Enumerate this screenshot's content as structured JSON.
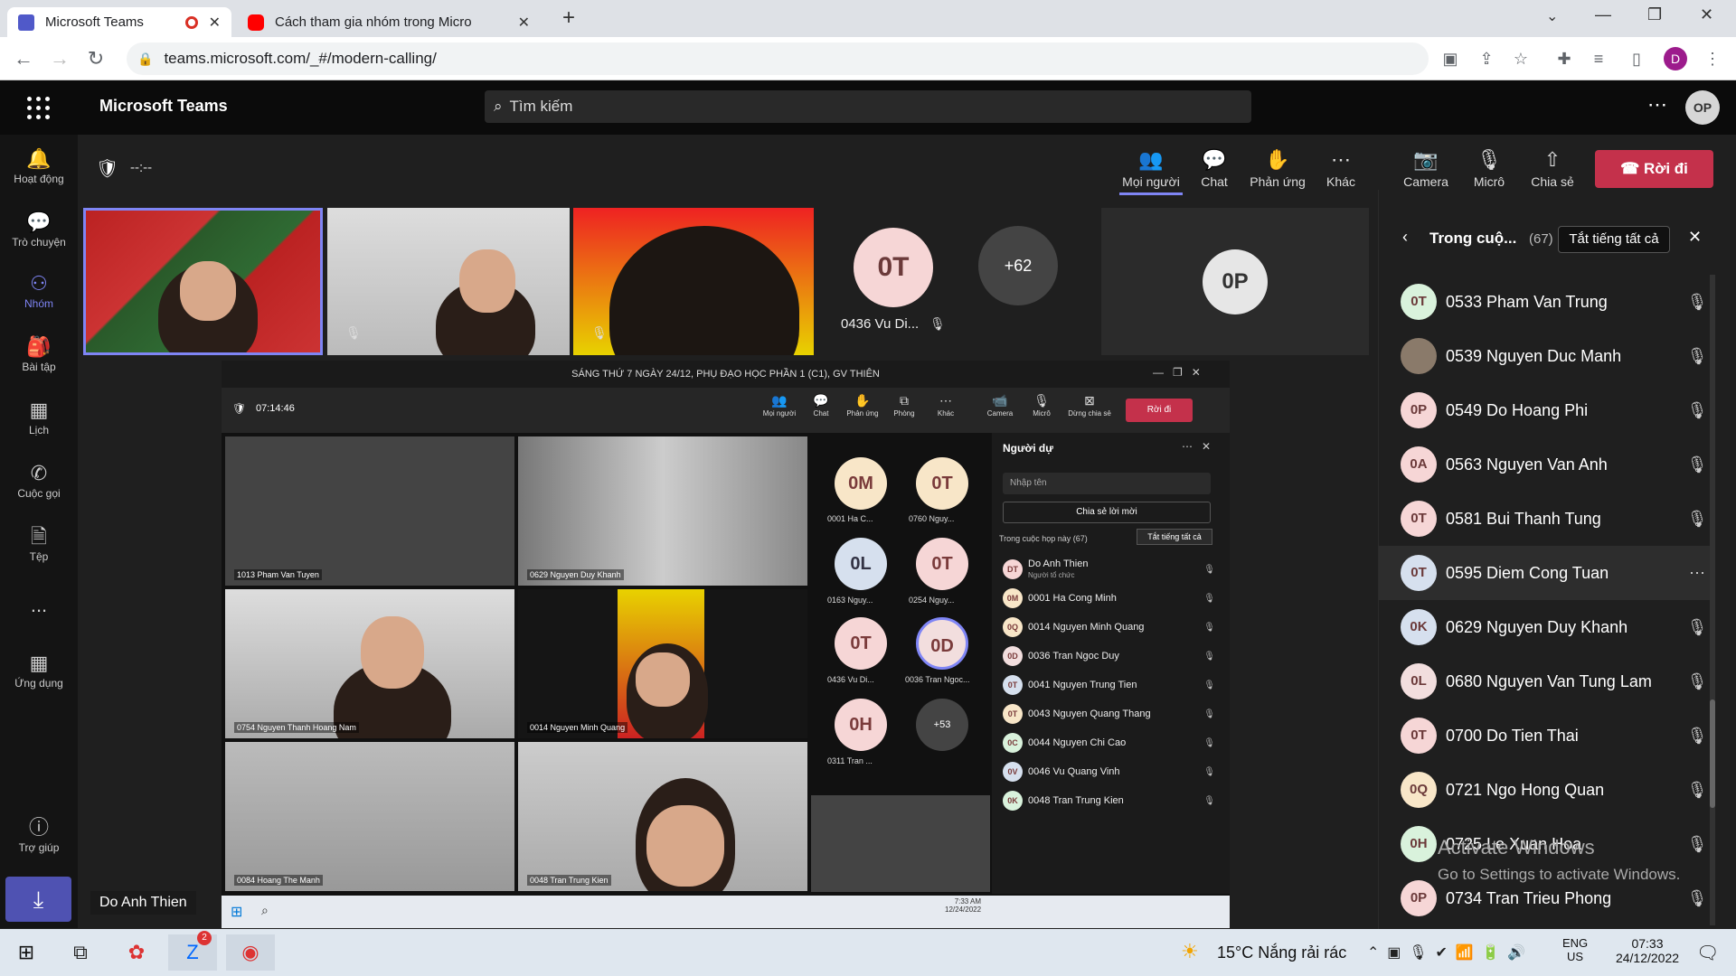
{
  "browser": {
    "tabs": [
      {
        "label": "Microsoft Teams",
        "active": true
      },
      {
        "label": "Cách tham gia nhóm trong Micro",
        "active": false
      }
    ],
    "new_tab": "+",
    "url": "teams.microsoft.com/_#/modern-calling/",
    "profile_initial": "D"
  },
  "teams": {
    "app_title": "Microsoft Teams",
    "search_placeholder": "Tìm kiếm",
    "user_initials": "OP",
    "rail": [
      {
        "label": "Hoạt động",
        "icon": "bell-icon"
      },
      {
        "label": "Trò chuyện",
        "icon": "chat-icon"
      },
      {
        "label": "Nhóm",
        "icon": "teams-icon",
        "selected": true
      },
      {
        "label": "Bài tập",
        "icon": "assignment-icon"
      },
      {
        "label": "Lịch",
        "icon": "calendar-icon"
      },
      {
        "label": "Cuộc gọi",
        "icon": "phone-icon"
      },
      {
        "label": "Tệp",
        "icon": "file-icon"
      },
      {
        "label": "...",
        "icon": "more-icon"
      },
      {
        "label": "Ứng dụng",
        "icon": "apps-icon"
      },
      {
        "label": "Trợ giúp",
        "icon": "help-icon"
      }
    ],
    "download_tooltip": "Do Anh Thien"
  },
  "meeting": {
    "timer": "--:--",
    "toolbar": [
      {
        "label": "Mọi người",
        "icon": "people-icon"
      },
      {
        "label": "Chat",
        "icon": "chat-icon"
      },
      {
        "label": "Phản ứng",
        "icon": "hand-icon"
      },
      {
        "label": "Khác",
        "icon": "more-icon"
      },
      {
        "label": "Camera",
        "icon": "camera-off-icon"
      },
      {
        "label": "Micrô",
        "icon": "mic-off-icon"
      },
      {
        "label": "Chia sẻ",
        "icon": "share-icon"
      }
    ],
    "leave_label": "Rời đi",
    "tiles": {
      "avatar_initials": "0T",
      "avatar_name": "0436 Vu Di...",
      "overflow": "+62",
      "self_initials": "0P"
    }
  },
  "shared_screen": {
    "title": "SÁNG THỨ 7 NGÀY 24/12, PHỤ ĐẠO HỌC PHẦN 1 (C1), GV THIÊN",
    "timer": "07:14:46",
    "toolbar": [
      "Mọi người",
      "Chat",
      "Phản ứng",
      "Phòng",
      "Khác",
      "Camera",
      "Micrô",
      "Dừng chia sẻ"
    ],
    "leave_label": "Rời đi",
    "video_labels": [
      "1013 Pham Van Tuyen",
      "0629 Nguyen Duy Khanh",
      "0754 Nguyen Thanh Hoang Nam",
      "0014 Nguyen Minh Quang",
      "0084 Hoang The Manh",
      "0048 Tran Trung Kien"
    ],
    "avatars": [
      {
        "i": "0M",
        "n": "0001 Ha C..."
      },
      {
        "i": "0T",
        "n": "0760 Nguy..."
      },
      {
        "i": "0L",
        "n": "0163 Nguy..."
      },
      {
        "i": "0T",
        "n": "0254 Nguy..."
      },
      {
        "i": "0T",
        "n": "0436 Vu Di..."
      },
      {
        "i": "0D",
        "n": "0036 Tran Ngoc..."
      },
      {
        "i": "0H",
        "n": "0311 Tran ..."
      }
    ],
    "overflow": "+53",
    "panel": {
      "title": "Người dự",
      "search_placeholder": "Nhập tên",
      "share_invite": "Chia sẻ lời mời",
      "section": "Trong cuộc họp này (67)",
      "mute_all": "Tắt tiếng tất cả",
      "people": [
        {
          "i": "DT",
          "n": "Do Anh Thien",
          "sub": "Người tổ chức"
        },
        {
          "i": "0M",
          "n": "0001 Ha Cong Minh"
        },
        {
          "i": "0Q",
          "n": "0014 Nguyen Minh Quang"
        },
        {
          "i": "0D",
          "n": "0036 Tran Ngoc Duy"
        },
        {
          "i": "0T",
          "n": "0041 Nguyen Trung Tien"
        },
        {
          "i": "0T",
          "n": "0043 Nguyen Quang Thang"
        },
        {
          "i": "0C",
          "n": "0044 Nguyen Chi Cao"
        },
        {
          "i": "0V",
          "n": "0046 Vu Quang Vinh"
        },
        {
          "i": "0K",
          "n": "0048 Tran Trung Kien"
        }
      ]
    },
    "taskbar_time": "7:33 AM",
    "taskbar_date": "12/24/2022"
  },
  "people_panel": {
    "title": "Trong cuộ...",
    "count": "(67)",
    "mute_all": "Tắt tiếng tất cả",
    "people": [
      {
        "i": "0T",
        "n": "0533 Pham Van Trung",
        "c": "#d9f2dc"
      },
      {
        "i": "",
        "n": "0539 Nguyen Duc Manh",
        "c": "#8a7a6a"
      },
      {
        "i": "0P",
        "n": "0549 Do Hoang Phi",
        "c": "#f6d6d6"
      },
      {
        "i": "0A",
        "n": "0563 Nguyen Van Anh",
        "c": "#f6d6d6"
      },
      {
        "i": "0T",
        "n": "0581 Bui Thanh Tung",
        "c": "#f6d6d6"
      },
      {
        "i": "0T",
        "n": "0595 Diem Cong Tuan",
        "c": "#d6e0ee",
        "hl": true
      },
      {
        "i": "0K",
        "n": "0629 Nguyen Duy Khanh",
        "c": "#d6e0ee"
      },
      {
        "i": "0L",
        "n": "0680 Nguyen Van Tung Lam",
        "c": "#f2dede"
      },
      {
        "i": "0T",
        "n": "0700 Do Tien Thai",
        "c": "#f6d6d6"
      },
      {
        "i": "0Q",
        "n": "0721 Ngo Hong Quan",
        "c": "#f8e6c8"
      },
      {
        "i": "0H",
        "n": "0725 Le Xuan Hoa",
        "c": "#d9f2dc"
      },
      {
        "i": "0P",
        "n": "0734 Tran Trieu Phong",
        "c": "#f6d6d6"
      }
    ]
  },
  "activation": {
    "line1": "Activate Windows",
    "line2": "Go to Settings to activate Windows."
  },
  "taskbar": {
    "weather": "15°C  Nắng rải rác",
    "lang1": "ENG",
    "lang2": "US",
    "time": "07:33",
    "date": "24/12/2022",
    "zalo_badge": "2"
  }
}
